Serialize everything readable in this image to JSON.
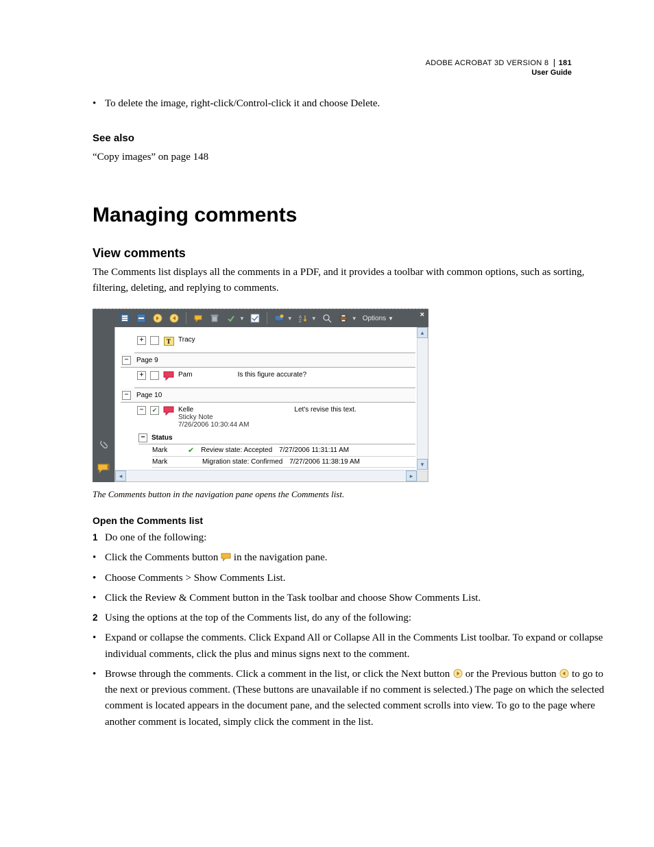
{
  "header": {
    "product": "ADOBE ACROBAT 3D VERSION 8",
    "page_number": "181",
    "subtitle": "User Guide"
  },
  "intro_bullet": "To delete the image, right-click/Control-click it and choose Delete.",
  "see_also": {
    "heading": "See also",
    "link": "“Copy images” on page 148"
  },
  "h1": "Managing comments",
  "h2": "View comments",
  "view_comments_para": "The Comments list displays all the comments in a PDF, and it provides a toolbar with common options, such as sorting, filtering, deleting, and replying to comments.",
  "figure": {
    "toolbar": {
      "options_label": "Options"
    },
    "tracy": {
      "author": "Tracy"
    },
    "page9_label": "Page 9",
    "pam": {
      "author": "Pam",
      "text": "Is this figure accurate?"
    },
    "page10_label": "Page 10",
    "kelle": {
      "author": "Kelle",
      "type": "Sticky Note",
      "date": "7/26/2006 10:30:44 AM",
      "text": "Let's revise this text."
    },
    "status_label": "Status",
    "status1": {
      "who": "Mark",
      "state": "Review state: Accepted",
      "ts": "7/27/2006 11:31:11 AM"
    },
    "status2": {
      "who": "Mark",
      "state": "Migration state: Confirmed",
      "ts": "7/27/2006 11:38:19 AM"
    }
  },
  "caption": "The Comments button in the navigation pane opens the Comments list.",
  "steps": {
    "heading": "Open the Comments list",
    "s1": "Do one of the following:",
    "s1b1a": "Click the Comments button ",
    "s1b1b": " in the navigation pane.",
    "s1b2": "Choose Comments > Show Comments List.",
    "s1b3": "Click the Review & Comment button in the Task toolbar and choose Show Comments List.",
    "s2": "Using the options at the top of the Comments list, do any of the following:",
    "s2b1": "Expand or collapse the comments. Click Expand All or Collapse All in the Comments List toolbar. To expand or collapse individual comments, click the plus and minus signs next to the comment.",
    "s2b2a": "Browse through the comments. Click a comment in the list, or click the Next button ",
    "s2b2b": " or the Previous button ",
    "s2b2c": " to go to the next or previous comment. (These buttons are unavailable if no comment is selected.) The page on which the selected comment is located appears in the document pane, and the selected comment scrolls into view. To go to the page where another comment is located, simply click the comment in the list."
  }
}
